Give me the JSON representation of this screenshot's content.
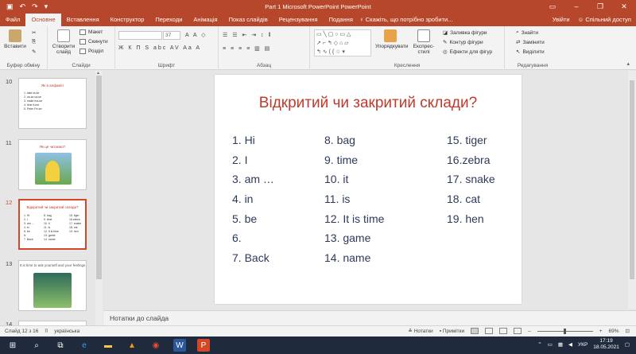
{
  "app": {
    "title": "Part 1 Microsoft PowerPoint  PowerPoint",
    "colors": {
      "accent": "#b7472a",
      "title_red": "#c0392b",
      "text_blue": "#2e3a59"
    }
  },
  "tabs": [
    "Файл",
    "Основне",
    "Вставлення",
    "Конструктор",
    "Переходи",
    "Анімація",
    "Показ слайдів",
    "Рецензування",
    "Подання"
  ],
  "tell_me": "Скажіть, що потрібно зробити...",
  "account": {
    "signin": "Увійти",
    "share": "Спільний доступ"
  },
  "ribbon": {
    "paste": "Вставити",
    "new_slide": "Створити слайд",
    "layout": "Макет",
    "reset": "Скинути",
    "section": "Розділ",
    "font_size": "37",
    "font_glyphs": "Ж К П S abc AV Aa A",
    "arrange": "Упорядкувати",
    "quick_styles": "Експрес-стилі",
    "shape_fill": "Заливка фігури",
    "shape_outline": "Контур фігури",
    "shape_effects": "Ефекти для фігур",
    "find": "Знайти",
    "replace": "Замінити",
    "select": "Виділити",
    "groups": [
      "Буфер обміну",
      "Слайди",
      "Шрифт",
      "Абзац",
      "Креслення",
      "Редагування"
    ]
  },
  "thumbnails": [
    {
      "num": "10",
      "title": "Як в алфавіті",
      "rows": [
        "1. take      ta-ke",
        "2. ca-se    ca-se",
        "3. make    ma-ke",
        "4. time     ti-me",
        "5. Peter   Pe-ter"
      ]
    },
    {
      "num": "11",
      "title": "Як це читаємо?"
    },
    {
      "num": "12",
      "title": "Відкритий чи закритий склади?"
    },
    {
      "num": "13",
      "title": "It is time to ask yourself and your feelings"
    },
    {
      "num": "14"
    }
  ],
  "slide": {
    "title": "Відкритий чи закритий склади?",
    "columns": [
      [
        "1. Hi",
        "2. I",
        "3. am …",
        "4. in",
        "5. be",
        "6.",
        "7. Back"
      ],
      [
        "8. bag",
        "9. time",
        "10. it",
        "11. is",
        "12. It is time",
        "13. game",
        "14. name"
      ],
      [
        "15. tiger",
        "16.zebra",
        "17. snake",
        "18. cat",
        "19. hen"
      ]
    ]
  },
  "notes_placeholder": "Нотатки до слайда",
  "status": {
    "slide_counter": "Слайд 12 з 16",
    "language": "українська",
    "notes_btn": "Нотатки",
    "comments_btn": "Примітки",
    "zoom": "69%"
  },
  "tray": {
    "lang": "УКР",
    "time": "17:19",
    "date": "18.05.2021"
  }
}
